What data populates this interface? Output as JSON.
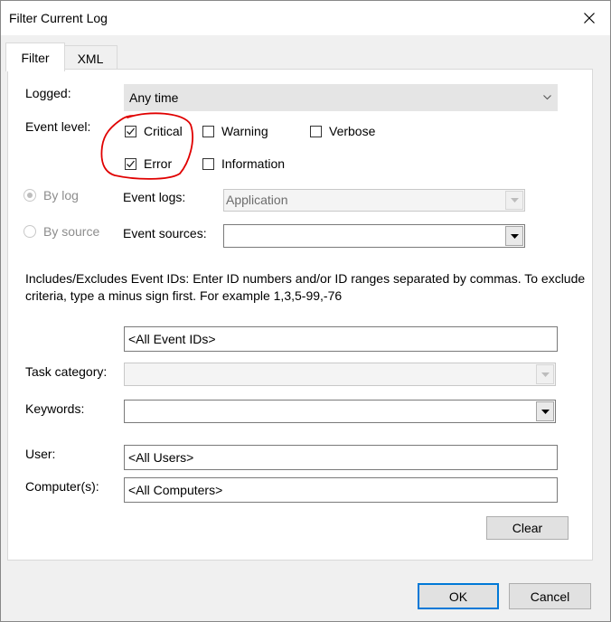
{
  "window": {
    "title": "Filter Current Log",
    "close_icon": "close-icon"
  },
  "tabs": [
    {
      "label": "Filter",
      "active": true
    },
    {
      "label": "XML",
      "active": false
    }
  ],
  "filter": {
    "logged": {
      "label": "Logged:",
      "value": "Any time"
    },
    "event_level": {
      "label": "Event level:",
      "critical": {
        "label": "Critical",
        "checked": true
      },
      "warning": {
        "label": "Warning",
        "checked": false
      },
      "verbose": {
        "label": "Verbose",
        "checked": false
      },
      "error": {
        "label": "Error",
        "checked": true
      },
      "information": {
        "label": "Information",
        "checked": false
      }
    },
    "by_log": {
      "label": "By log",
      "selected": true
    },
    "by_source": {
      "label": "By source",
      "selected": false
    },
    "event_logs": {
      "label": "Event logs:",
      "value": "Application"
    },
    "event_sources": {
      "label": "Event sources:",
      "value": ""
    },
    "event_ids_note": "Includes/Excludes Event IDs: Enter ID numbers and/or ID ranges separated by commas. To exclude criteria, type a minus sign first. For example 1,3,5-99,-76",
    "event_ids": {
      "value": "<All Event IDs>"
    },
    "task_category": {
      "label": "Task category:",
      "value": ""
    },
    "keywords": {
      "label": "Keywords:",
      "value": ""
    },
    "user": {
      "label": "User:",
      "value": "<All Users>"
    },
    "computers": {
      "label": "Computer(s):",
      "value": "<All Computers>"
    },
    "clear_label": "Clear"
  },
  "footer": {
    "ok_label": "OK",
    "cancel_label": "Cancel"
  },
  "colors": {
    "annotation": "#e00000",
    "accent": "#0078d7"
  }
}
